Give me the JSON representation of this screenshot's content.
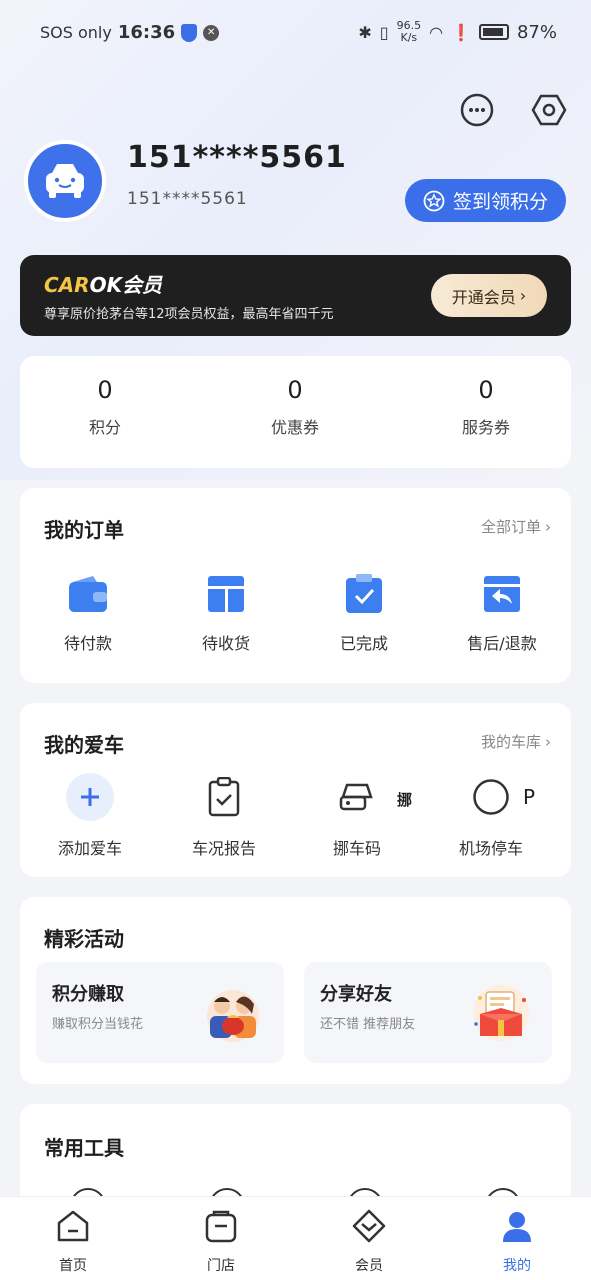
{
  "status_bar": {
    "carrier": "SOS only",
    "time": "16:36",
    "speed_value": "96.5",
    "speed_unit": "K/s",
    "battery": "87%"
  },
  "profile": {
    "name": "151****5561",
    "id": "151****5561",
    "checkin_label": "签到领积分"
  },
  "member": {
    "brand_car": "CAR",
    "brand_ok": "OK",
    "brand_suffix": "会员",
    "desc": "尊享原价抢茅台等12项会员权益，最高年省四千元",
    "button": "开通会员"
  },
  "stats": [
    {
      "value": "0",
      "label": "积分"
    },
    {
      "value": "0",
      "label": "优惠券"
    },
    {
      "value": "0",
      "label": "服务券"
    }
  ],
  "orders": {
    "title": "我的订单",
    "link": "全部订单",
    "items": [
      {
        "label": "待付款",
        "icon": "wallet-icon"
      },
      {
        "label": "待收货",
        "icon": "package-icon"
      },
      {
        "label": "已完成",
        "icon": "clipboard-check-icon"
      },
      {
        "label": "售后/退款",
        "icon": "refund-icon"
      }
    ]
  },
  "cars": {
    "title": "我的爱车",
    "link": "我的车库",
    "items": [
      {
        "label": "添加爱车",
        "icon": "plus-icon"
      },
      {
        "label": "车况报告",
        "icon": "report-icon"
      },
      {
        "label": "挪车码",
        "icon": "move-car-icon",
        "glyph": "挪"
      },
      {
        "label": "机场停车",
        "icon": "parking-icon",
        "glyph": "P"
      }
    ]
  },
  "activities": {
    "title": "精彩活动",
    "items": [
      {
        "title": "积分赚取",
        "desc": "赚取积分当钱花"
      },
      {
        "title": "分享好友",
        "desc": "还不错 推荐朋友"
      }
    ]
  },
  "tools": {
    "title": "常用工具"
  },
  "nav": [
    {
      "label": "首页",
      "icon": "home-icon"
    },
    {
      "label": "门店",
      "icon": "store-icon"
    },
    {
      "label": "会员",
      "icon": "member-icon"
    },
    {
      "label": "我的",
      "icon": "profile-icon"
    }
  ],
  "colors": {
    "accent": "#3a6fe9",
    "banner": "#1f1f1f",
    "brand_yellow": "#f4c544"
  }
}
